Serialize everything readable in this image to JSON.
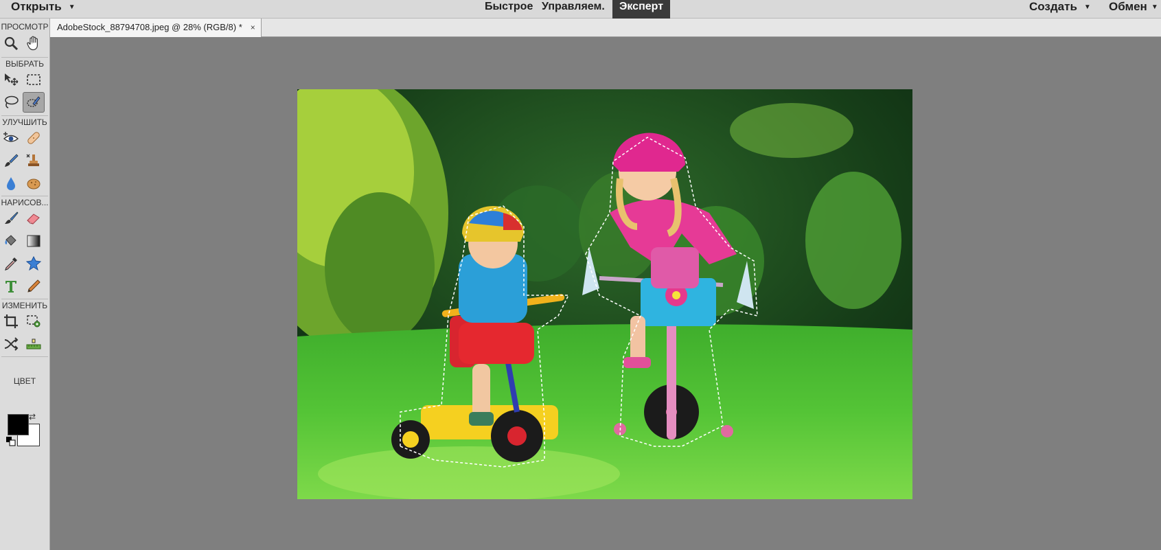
{
  "menubar": {
    "open_label": "Открыть",
    "modes": [
      "Быстрое",
      "Управляем.",
      "Эксперт"
    ],
    "active_mode": "Эксперт",
    "create_label": "Создать",
    "share_label": "Обмен"
  },
  "document_tab": {
    "title": "AdobeStock_88794708.jpeg @ 28% (RGB/8) *",
    "close_glyph": "×"
  },
  "toolbox": {
    "sections": {
      "view": "ПРОСМОТР",
      "select": "ВЫБРАТЬ",
      "enhance": "УЛУЧШИТЬ",
      "draw": "НАРИСОВ...",
      "modify": "ИЗМЕНИТЬ",
      "color": "ЦВЕТ"
    },
    "tools": [
      "zoom-icon",
      "hand-icon",
      "move-icon",
      "marquee-icon",
      "lasso-icon",
      "quick-selection-icon",
      "red-eye-icon",
      "spot-healing-icon",
      "smart-brush-icon",
      "clone-stamp-icon",
      "blur-icon",
      "sponge-icon",
      "brush-icon",
      "eraser-icon",
      "paint-bucket-icon",
      "gradient-icon",
      "eyedropper-icon",
      "custom-shape-icon",
      "type-icon",
      "pencil-icon",
      "crop-icon",
      "recompose-icon",
      "content-aware-move-icon",
      "straighten-icon"
    ],
    "selected_tool": "quick-selection-icon",
    "foreground_color": "#000000",
    "background_color": "#ffffff"
  },
  "image": {
    "description_icon": "photo-canvas",
    "zoom_percent": 28
  }
}
